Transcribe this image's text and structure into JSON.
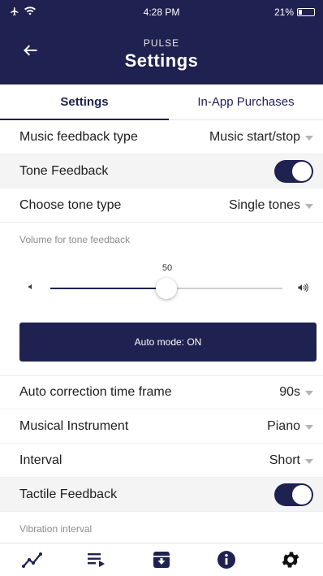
{
  "status": {
    "time": "4:28 PM",
    "battery": "21%",
    "battery_level": 0.21
  },
  "header": {
    "subtitle": "PULSE",
    "title": "Settings"
  },
  "tabs": [
    {
      "label": "Settings"
    },
    {
      "label": "In-App Purchases"
    }
  ],
  "settings": {
    "music_feedback": {
      "label": "Music feedback type",
      "value": "Music start/stop"
    },
    "tone_feedback": {
      "label": "Tone Feedback",
      "on": true
    },
    "tone_type": {
      "label": "Choose tone type",
      "value": "Single tones"
    },
    "volume": {
      "label": "Volume for tone feedback",
      "value": "50",
      "level": 0.5
    },
    "auto_mode": {
      "label": "Auto mode: ON"
    },
    "auto_correction": {
      "label": "Auto correction time frame",
      "value": "90s"
    },
    "instrument": {
      "label": "Musical Instrument",
      "value": "Piano"
    },
    "interval": {
      "label": "Interval",
      "value": "Short"
    },
    "tactile": {
      "label": "Tactile Feedback",
      "on": true
    },
    "vibration": {
      "label": "Vibration interval"
    }
  },
  "bottom_nav": [
    {
      "icon": "chart-line-icon"
    },
    {
      "icon": "playlist-icon"
    },
    {
      "icon": "archive-icon"
    },
    {
      "icon": "info-icon"
    },
    {
      "icon": "gear-icon"
    }
  ],
  "colors": {
    "primary": "#1f2150",
    "shaded_row": "#f4f4f4",
    "caret": "#b3b3b3"
  }
}
